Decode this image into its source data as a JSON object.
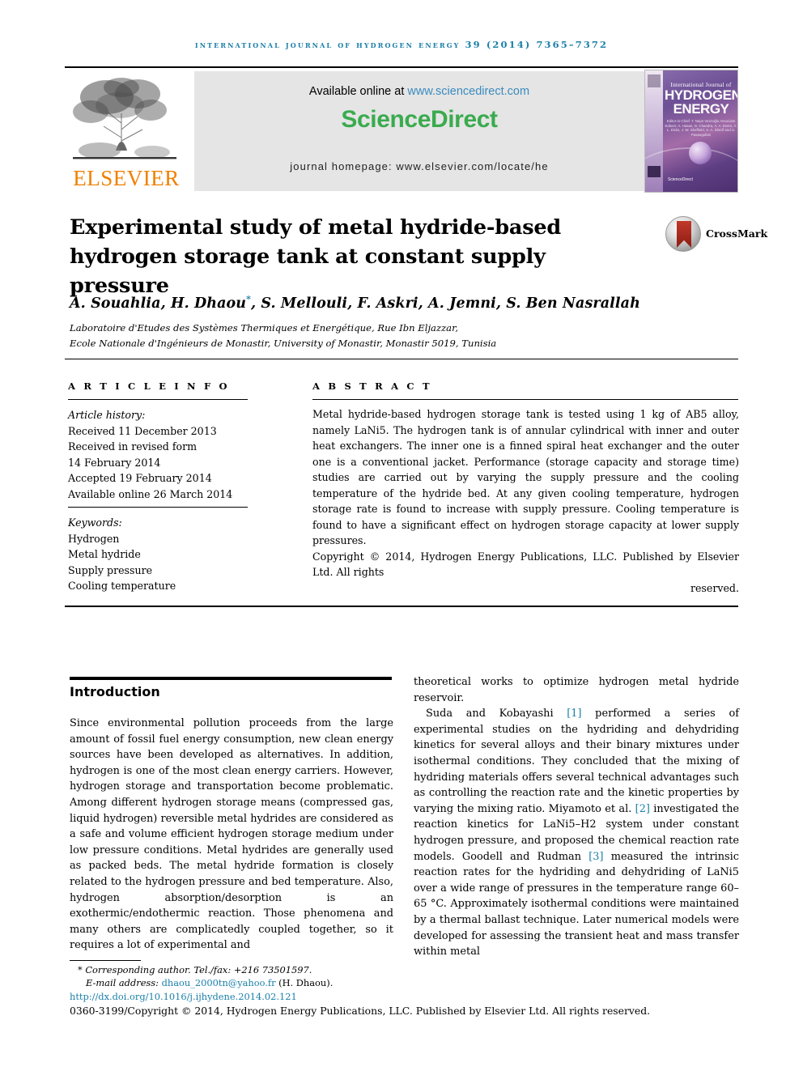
{
  "running_head": "International Journal of Hydrogen Energy 39 (2014) 7365–7372",
  "masthead": {
    "publisher_logo_text": "ELSEVIER",
    "available_prefix": "Available online at ",
    "available_url": "www.sciencedirect.com",
    "sciencedirect_logo": "ScienceDirect",
    "journal_homepage": "journal homepage: www.elsevier.com/locate/he",
    "cover": {
      "line1": "International Journal of",
      "line2": "HYDROGEN",
      "line3": "ENERGY",
      "editors": "Editor-in-Chief: T. Nejat Veziroğlu    Associate Editors: A. Hasan, D. Chandra, A. A. Evers, A. L. Dicks, J. W. Sheffield, S. A. Sherif and U. Pasaogullari",
      "sciencedirect_mark": "ScienceDirect"
    },
    "colors": {
      "link_blue": "#3a8bbf",
      "sciencedirect_green": "#3aab4e",
      "elsevier_orange": "#f08000",
      "runhead_teal": "#1a7fa8"
    }
  },
  "article": {
    "title": "Experimental study of metal hydride-based hydrogen storage tank at constant supply pressure",
    "crossmark_label": "CrossMark",
    "authors": "A. Souahlia, H. Dhaou",
    "authors_star": "*",
    "authors_rest": ", S. Mellouli, F. Askri, A. Jemni, S. Ben Nasrallah",
    "affiliation_line1": "Laboratoire d'Etudes des Systèmes Thermiques et Energétique, Rue Ibn Eljazzar,",
    "affiliation_line2": "Ecole Nationale d'Ingénieurs de Monastir, University of Monastir, Monastir 5019, Tunisia"
  },
  "article_info": {
    "heading": "A R T I C L E   I N F O",
    "history_label": "Article history:",
    "history": [
      "Received 11 December 2013",
      "Received in revised form",
      "14 February 2014",
      "Accepted 19 February 2014",
      "Available online 26 March 2014"
    ],
    "keywords_label": "Keywords:",
    "keywords": [
      "Hydrogen",
      "Metal hydride",
      "Supply pressure",
      "Cooling temperature"
    ]
  },
  "abstract": {
    "heading": "A B S T R A C T",
    "body": "Metal hydride-based hydrogen storage tank is tested using 1 kg of AB5 alloy, namely LaNi5. The hydrogen tank is of annular cylindrical with inner and outer heat exchangers. The inner one is a finned spiral heat exchanger and the outer one is a conventional jacket. Performance (storage capacity and storage time) studies are carried out by varying the supply pressure and the cooling temperature of the hydride bed. At any given cooling temperature, hydrogen storage rate is found to increase with supply pressure. Cooling temperature is found to have a significant effect on hydrogen storage capacity at lower supply pressures.",
    "copyright": "Copyright © 2014, Hydrogen Energy Publications, LLC. Published by Elsevier Ltd. All rights",
    "copyright_last": "reserved."
  },
  "body": {
    "intro_heading": "Introduction",
    "left_column": "Since environmental pollution proceeds from the large amount of fossil fuel energy consumption, new clean energy sources have been developed as alternatives. In addition, hydrogen is one of the most clean energy carriers. However, hydrogen storage and transportation become problematic. Among different hydrogen storage means (compressed gas, liquid hydrogen) reversible metal hydrides are considered as a safe and volume efficient hydrogen storage medium under low pressure conditions. Metal hydrides are generally used as packed beds. The metal hydride formation is closely related to the hydrogen pressure and bed temperature. Also, hydrogen absorption/desorption is an exothermic/endothermic reaction. Those phenomena and many others are complicatedly coupled together, so it requires a lot of experimental and",
    "right_para1": "theoretical works to optimize hydrogen metal hydride reservoir.",
    "right_para2_a": "Suda and Kobayashi ",
    "right_ref1": "[1]",
    "right_para2_b": " performed a series of experimental studies on the hydriding and dehydriding kinetics for several alloys and their binary mixtures under isothermal conditions. They concluded that the mixing of hydriding materials offers several technical advantages such as controlling the reaction rate and the kinetic properties by varying the mixing ratio. Miyamoto et al. ",
    "right_ref2": "[2]",
    "right_para2_c": " investigated the reaction kinetics for LaNi5–H2 system under constant hydrogen pressure, and proposed the chemical reaction rate models. Goodell and Rudman ",
    "right_ref3": "[3]",
    "right_para2_d": " measured the intrinsic reaction rates for the hydriding and dehydriding of LaNi5 over a wide range of pressures in the temperature range 60–65 °C. Approximately isothermal conditions were maintained by a thermal ballast technique. Later numerical models were developed for assessing the transient heat and mass transfer within metal"
  },
  "footer": {
    "corresponding_star": "*",
    "corresponding": " Corresponding author. Tel./fax: +216 73501597.",
    "email_label": "E-mail address: ",
    "email": "dhaou_2000tn@yahoo.fr",
    "email_suffix": " (H. Dhaou).",
    "doi": "http://dx.doi.org/10.1016/j.ijhydene.2014.02.121",
    "issn_line": "0360-3199/Copyright © 2014, Hydrogen Energy Publications, LLC. Published by Elsevier Ltd. All rights reserved."
  }
}
